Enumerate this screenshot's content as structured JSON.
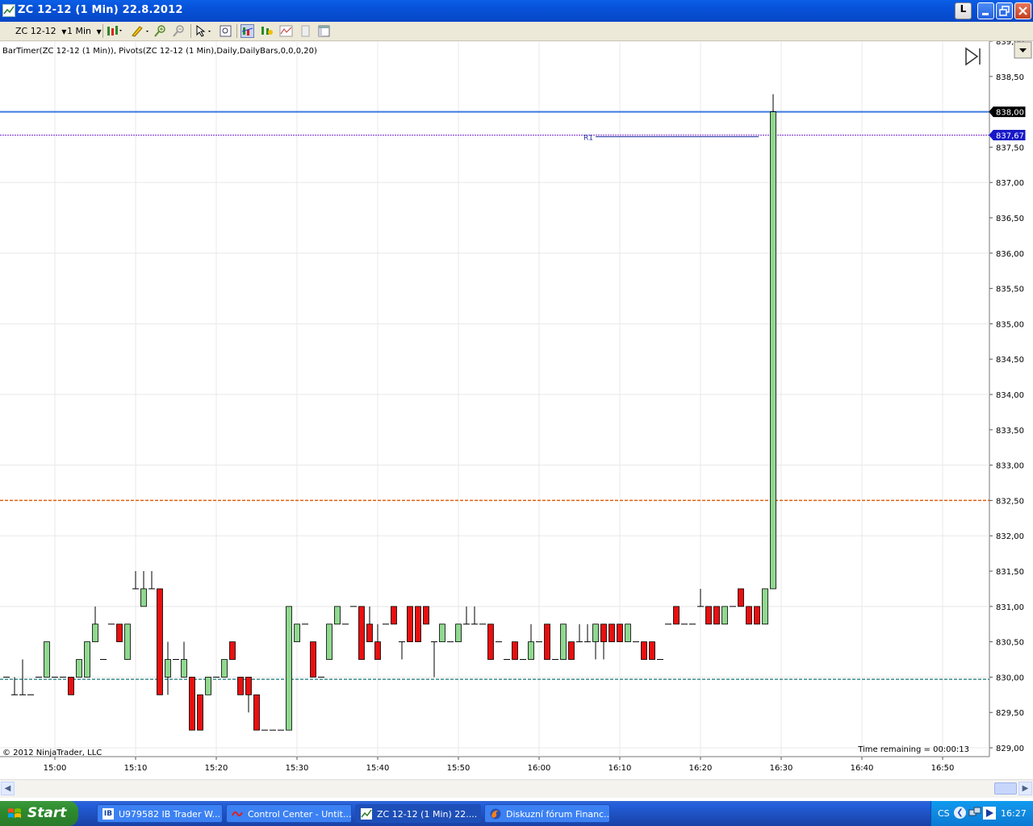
{
  "window": {
    "title": "ZC 12-12 (1 Min)  22.8.2012",
    "btn_l": "L"
  },
  "toolbar": {
    "instrument": "ZC 12-12",
    "interval": "1 Min"
  },
  "chart": {
    "indicator_label": "BarTimer(ZC 12-12 (1 Min)), Pivots(ZC 12-12 (1 Min),Daily,DailyBars,0,0,0,20)",
    "copyright": "© 2012 NinjaTrader, LLC",
    "time_remaining": "Time remaining = 00:00:13",
    "r1_label": "R1",
    "price_labels": [
      "839,00",
      "838,50",
      "838,00",
      "837,50",
      "837,00",
      "836,50",
      "836,00",
      "835,50",
      "835,00",
      "834,50",
      "834,00",
      "833,50",
      "833,00",
      "832,50",
      "832,00",
      "831,50",
      "831,00",
      "830,50",
      "830,00",
      "829,50",
      "829,00"
    ],
    "time_labels": [
      "15:00",
      "15:10",
      "15:20",
      "15:30",
      "15:40",
      "15:50",
      "16:00",
      "16:10",
      "16:20",
      "16:30",
      "16:40",
      "16:50"
    ],
    "last_price": "838,00",
    "r1_price": "837,67",
    "colors": {
      "up": "#90d890",
      "down": "#e81010",
      "last_line": "#3a7ae0",
      "r1": "#7b2fd0",
      "pp": "#e06010",
      "s1": "#3a8c8c"
    }
  },
  "chart_data": {
    "type": "candlestick",
    "y_range": [
      828.875,
      839.0
    ],
    "time_start": "14:54",
    "levels": {
      "last": 838.0,
      "r1": 837.67,
      "pp": 832.5,
      "s1": 829.97
    },
    "candles": [
      {
        "t": "14:54",
        "o": 830.0,
        "h": 830.0,
        "l": 830.0,
        "c": 830.0
      },
      {
        "t": "14:55",
        "o": 829.75,
        "h": 830.0,
        "l": 829.75,
        "c": 829.75
      },
      {
        "t": "14:56",
        "o": 829.75,
        "h": 830.25,
        "l": 829.75,
        "c": 829.75
      },
      {
        "t": "14:57",
        "o": 829.75,
        "h": 829.75,
        "l": 829.75,
        "c": 829.75
      },
      {
        "t": "14:58",
        "o": 830.0,
        "h": 830.0,
        "l": 830.0,
        "c": 830.0
      },
      {
        "t": "14:59",
        "o": 830.0,
        "h": 830.5,
        "l": 830.0,
        "c": 830.5
      },
      {
        "t": "15:00",
        "o": 830.0,
        "h": 830.0,
        "l": 830.0,
        "c": 830.0
      },
      {
        "t": "15:01",
        "o": 830.0,
        "h": 830.0,
        "l": 830.0,
        "c": 830.0
      },
      {
        "t": "15:02",
        "o": 830.0,
        "h": 830.0,
        "l": 829.75,
        "c": 829.75
      },
      {
        "t": "15:03",
        "o": 830.0,
        "h": 830.25,
        "l": 830.0,
        "c": 830.25
      },
      {
        "t": "15:04",
        "o": 830.0,
        "h": 830.5,
        "l": 830.0,
        "c": 830.5
      },
      {
        "t": "15:05",
        "o": 830.5,
        "h": 831.0,
        "l": 830.5,
        "c": 830.75
      },
      {
        "t": "15:06",
        "o": 830.25,
        "h": 830.25,
        "l": 830.25,
        "c": 830.25
      },
      {
        "t": "15:07",
        "o": 830.75,
        "h": 830.75,
        "l": 830.75,
        "c": 830.75
      },
      {
        "t": "15:08",
        "o": 830.75,
        "h": 830.75,
        "l": 830.5,
        "c": 830.5
      },
      {
        "t": "15:09",
        "o": 830.25,
        "h": 830.75,
        "l": 830.25,
        "c": 830.75
      },
      {
        "t": "15:10",
        "o": 831.25,
        "h": 831.5,
        "l": 831.25,
        "c": 831.25
      },
      {
        "t": "15:11",
        "o": 831.0,
        "h": 831.5,
        "l": 831.0,
        "c": 831.25
      },
      {
        "t": "15:12",
        "o": 831.25,
        "h": 831.5,
        "l": 831.25,
        "c": 831.25
      },
      {
        "t": "15:13",
        "o": 831.25,
        "h": 831.25,
        "l": 829.75,
        "c": 829.75
      },
      {
        "t": "15:14",
        "o": 830.0,
        "h": 830.5,
        "l": 829.75,
        "c": 830.25
      },
      {
        "t": "15:15",
        "o": 830.25,
        "h": 830.25,
        "l": 830.25,
        "c": 830.25
      },
      {
        "t": "15:16",
        "o": 830.0,
        "h": 830.5,
        "l": 830.0,
        "c": 830.25
      },
      {
        "t": "15:17",
        "o": 830.0,
        "h": 830.0,
        "l": 829.25,
        "c": 829.25
      },
      {
        "t": "15:18",
        "o": 829.75,
        "h": 829.75,
        "l": 829.25,
        "c": 829.25
      },
      {
        "t": "15:19",
        "o": 829.75,
        "h": 830.0,
        "l": 829.75,
        "c": 830.0
      },
      {
        "t": "15:20",
        "o": 830.0,
        "h": 830.0,
        "l": 830.0,
        "c": 830.0
      },
      {
        "t": "15:21",
        "o": 830.0,
        "h": 830.25,
        "l": 830.0,
        "c": 830.25
      },
      {
        "t": "15:22",
        "o": 830.5,
        "h": 830.5,
        "l": 830.25,
        "c": 830.25
      },
      {
        "t": "15:23",
        "o": 830.0,
        "h": 830.0,
        "l": 829.75,
        "c": 829.75
      },
      {
        "t": "15:24",
        "o": 830.0,
        "h": 830.0,
        "l": 829.5,
        "c": 829.75
      },
      {
        "t": "15:25",
        "o": 829.75,
        "h": 829.75,
        "l": 829.25,
        "c": 829.25
      },
      {
        "t": "15:26",
        "o": 829.25,
        "h": 829.25,
        "l": 829.25,
        "c": 829.25
      },
      {
        "t": "15:27",
        "o": 829.25,
        "h": 829.25,
        "l": 829.25,
        "c": 829.25
      },
      {
        "t": "15:28",
        "o": 829.25,
        "h": 829.25,
        "l": 829.25,
        "c": 829.25
      },
      {
        "t": "15:29",
        "o": 829.25,
        "h": 831.0,
        "l": 829.25,
        "c": 831.0
      },
      {
        "t": "15:30",
        "o": 830.5,
        "h": 830.75,
        "l": 830.5,
        "c": 830.75
      },
      {
        "t": "15:31",
        "o": 830.75,
        "h": 830.75,
        "l": 830.75,
        "c": 830.75
      },
      {
        "t": "15:32",
        "o": 830.5,
        "h": 830.5,
        "l": 830.0,
        "c": 830.0
      },
      {
        "t": "15:33",
        "o": 830.0,
        "h": 830.0,
        "l": 830.0,
        "c": 830.0
      },
      {
        "t": "15:34",
        "o": 830.25,
        "h": 830.75,
        "l": 830.25,
        "c": 830.75
      },
      {
        "t": "15:35",
        "o": 830.75,
        "h": 831.0,
        "l": 830.75,
        "c": 831.0
      },
      {
        "t": "15:36",
        "o": 830.75,
        "h": 830.75,
        "l": 830.75,
        "c": 830.75
      },
      {
        "t": "15:37",
        "o": 831.0,
        "h": 831.0,
        "l": 831.0,
        "c": 831.0
      },
      {
        "t": "15:38",
        "o": 831.0,
        "h": 831.0,
        "l": 830.25,
        "c": 830.25
      },
      {
        "t": "15:39",
        "o": 830.75,
        "h": 831.0,
        "l": 830.5,
        "c": 830.5
      },
      {
        "t": "15:40",
        "o": 830.5,
        "h": 830.75,
        "l": 830.25,
        "c": 830.25
      },
      {
        "t": "15:41",
        "o": 830.75,
        "h": 830.75,
        "l": 830.75,
        "c": 830.75
      },
      {
        "t": "15:42",
        "o": 831.0,
        "h": 831.0,
        "l": 830.75,
        "c": 830.75
      },
      {
        "t": "15:43",
        "o": 830.5,
        "h": 830.5,
        "l": 830.25,
        "c": 830.5
      },
      {
        "t": "15:44",
        "o": 831.0,
        "h": 831.0,
        "l": 830.5,
        "c": 830.5
      },
      {
        "t": "15:45",
        "o": 831.0,
        "h": 831.0,
        "l": 830.5,
        "c": 830.5
      },
      {
        "t": "15:46",
        "o": 831.0,
        "h": 831.0,
        "l": 830.75,
        "c": 830.75
      },
      {
        "t": "15:47",
        "o": 830.5,
        "h": 830.5,
        "l": 830.0,
        "c": 830.5
      },
      {
        "t": "15:48",
        "o": 830.5,
        "h": 830.75,
        "l": 830.5,
        "c": 830.75
      },
      {
        "t": "15:49",
        "o": 830.5,
        "h": 830.5,
        "l": 830.5,
        "c": 830.5
      },
      {
        "t": "15:50",
        "o": 830.5,
        "h": 830.75,
        "l": 830.5,
        "c": 830.75
      },
      {
        "t": "15:51",
        "o": 830.75,
        "h": 831.0,
        "l": 830.75,
        "c": 830.75
      },
      {
        "t": "15:52",
        "o": 830.75,
        "h": 831.0,
        "l": 830.75,
        "c": 830.75
      },
      {
        "t": "15:53",
        "o": 830.75,
        "h": 830.75,
        "l": 830.75,
        "c": 830.75
      },
      {
        "t": "15:54",
        "o": 830.75,
        "h": 830.75,
        "l": 830.25,
        "c": 830.25
      },
      {
        "t": "15:55",
        "o": 830.5,
        "h": 830.5,
        "l": 830.5,
        "c": 830.5
      },
      {
        "t": "15:56",
        "o": 830.25,
        "h": 830.25,
        "l": 830.25,
        "c": 830.25
      },
      {
        "t": "15:57",
        "o": 830.5,
        "h": 830.5,
        "l": 830.25,
        "c": 830.25
      },
      {
        "t": "15:58",
        "o": 830.25,
        "h": 830.25,
        "l": 830.25,
        "c": 830.25
      },
      {
        "t": "15:59",
        "o": 830.25,
        "h": 830.75,
        "l": 830.25,
        "c": 830.5
      },
      {
        "t": "16:00",
        "o": 830.5,
        "h": 830.5,
        "l": 830.5,
        "c": 830.5
      },
      {
        "t": "16:01",
        "o": 830.75,
        "h": 830.75,
        "l": 830.25,
        "c": 830.25
      },
      {
        "t": "16:02",
        "o": 830.25,
        "h": 830.25,
        "l": 830.25,
        "c": 830.25
      },
      {
        "t": "16:03",
        "o": 830.25,
        "h": 830.75,
        "l": 830.25,
        "c": 830.75
      },
      {
        "t": "16:04",
        "o": 830.5,
        "h": 830.5,
        "l": 830.25,
        "c": 830.25
      },
      {
        "t": "16:05",
        "o": 830.5,
        "h": 830.75,
        "l": 830.5,
        "c": 830.5
      },
      {
        "t": "16:06",
        "o": 830.5,
        "h": 830.75,
        "l": 830.5,
        "c": 830.5
      },
      {
        "t": "16:07",
        "o": 830.5,
        "h": 830.75,
        "l": 830.25,
        "c": 830.75
      },
      {
        "t": "16:08",
        "o": 830.75,
        "h": 830.75,
        "l": 830.25,
        "c": 830.5
      },
      {
        "t": "16:09",
        "o": 830.75,
        "h": 830.75,
        "l": 830.5,
        "c": 830.5
      },
      {
        "t": "16:10",
        "o": 830.75,
        "h": 830.75,
        "l": 830.5,
        "c": 830.5
      },
      {
        "t": "16:11",
        "o": 830.5,
        "h": 830.75,
        "l": 830.5,
        "c": 830.75
      },
      {
        "t": "16:12",
        "o": 830.5,
        "h": 830.5,
        "l": 830.5,
        "c": 830.5
      },
      {
        "t": "16:13",
        "o": 830.5,
        "h": 830.5,
        "l": 830.25,
        "c": 830.25
      },
      {
        "t": "16:14",
        "o": 830.5,
        "h": 830.5,
        "l": 830.25,
        "c": 830.25
      },
      {
        "t": "16:15",
        "o": 830.25,
        "h": 830.25,
        "l": 830.25,
        "c": 830.25
      },
      {
        "t": "16:16",
        "o": 830.75,
        "h": 830.75,
        "l": 830.75,
        "c": 830.75
      },
      {
        "t": "16:17",
        "o": 831.0,
        "h": 831.0,
        "l": 830.75,
        "c": 830.75
      },
      {
        "t": "16:18",
        "o": 830.75,
        "h": 830.75,
        "l": 830.75,
        "c": 830.75
      },
      {
        "t": "16:19",
        "o": 830.75,
        "h": 830.75,
        "l": 830.75,
        "c": 830.75
      },
      {
        "t": "16:20",
        "o": 831.0,
        "h": 831.25,
        "l": 831.0,
        "c": 831.0
      },
      {
        "t": "16:21",
        "o": 831.0,
        "h": 831.0,
        "l": 830.75,
        "c": 830.75
      },
      {
        "t": "16:22",
        "o": 831.0,
        "h": 831.0,
        "l": 830.75,
        "c": 830.75
      },
      {
        "t": "16:23",
        "o": 830.75,
        "h": 831.0,
        "l": 830.75,
        "c": 831.0
      },
      {
        "t": "16:24",
        "o": 831.0,
        "h": 831.0,
        "l": 831.0,
        "c": 831.0
      },
      {
        "t": "16:25",
        "o": 831.25,
        "h": 831.25,
        "l": 831.0,
        "c": 831.0
      },
      {
        "t": "16:26",
        "o": 831.0,
        "h": 831.0,
        "l": 830.75,
        "c": 830.75
      },
      {
        "t": "16:27",
        "o": 831.0,
        "h": 831.0,
        "l": 830.75,
        "c": 830.75
      },
      {
        "t": "16:28",
        "o": 830.75,
        "h": 831.25,
        "l": 830.75,
        "c": 831.25
      },
      {
        "t": "16:29",
        "o": 831.25,
        "h": 838.25,
        "l": 831.25,
        "c": 838.0
      }
    ]
  },
  "taskbar": {
    "start_label": "Start",
    "tasks": [
      {
        "label": "U979582 IB Trader W..."
      },
      {
        "label": "Control Center - Untit..."
      },
      {
        "label": "ZC 12-12 (1 Min)  22...."
      },
      {
        "label": "Diskuzní fórum Financ..."
      }
    ],
    "lang": "CS",
    "clock": "16:27"
  }
}
